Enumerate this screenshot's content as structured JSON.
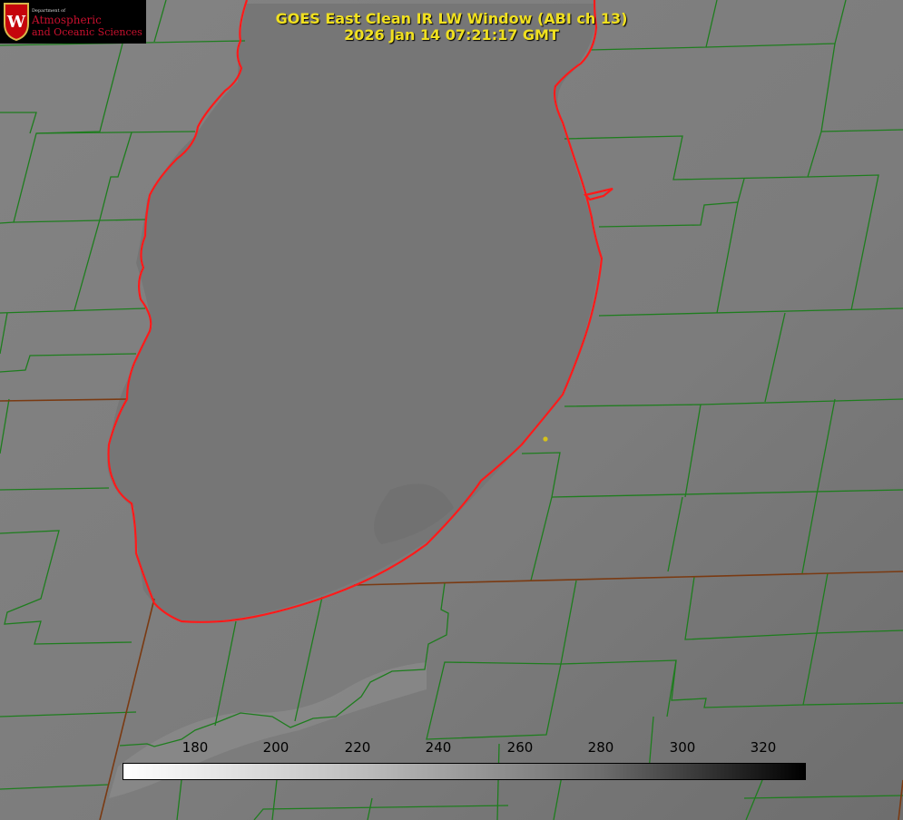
{
  "title": {
    "line1": "GOES East Clean IR LW Window (ABI ch 13)",
    "line2": "2026 Jan 14 07:21:17 GMT"
  },
  "logo": {
    "department": "Department of",
    "line1": "Atmospheric",
    "line2": "and Oceanic Sciences"
  },
  "colorbar": {
    "ticks": [
      "180",
      "200",
      "220",
      "240",
      "260",
      "280",
      "300",
      "320"
    ]
  },
  "colors": {
    "background": "#7e7e7e",
    "lake": "#747474",
    "county_lines": "#1e7d1e",
    "state_lines": "#7a3a12",
    "coastline": "#ff1a1a",
    "title_text": "#f0e020",
    "marker": "#d6c21a"
  }
}
